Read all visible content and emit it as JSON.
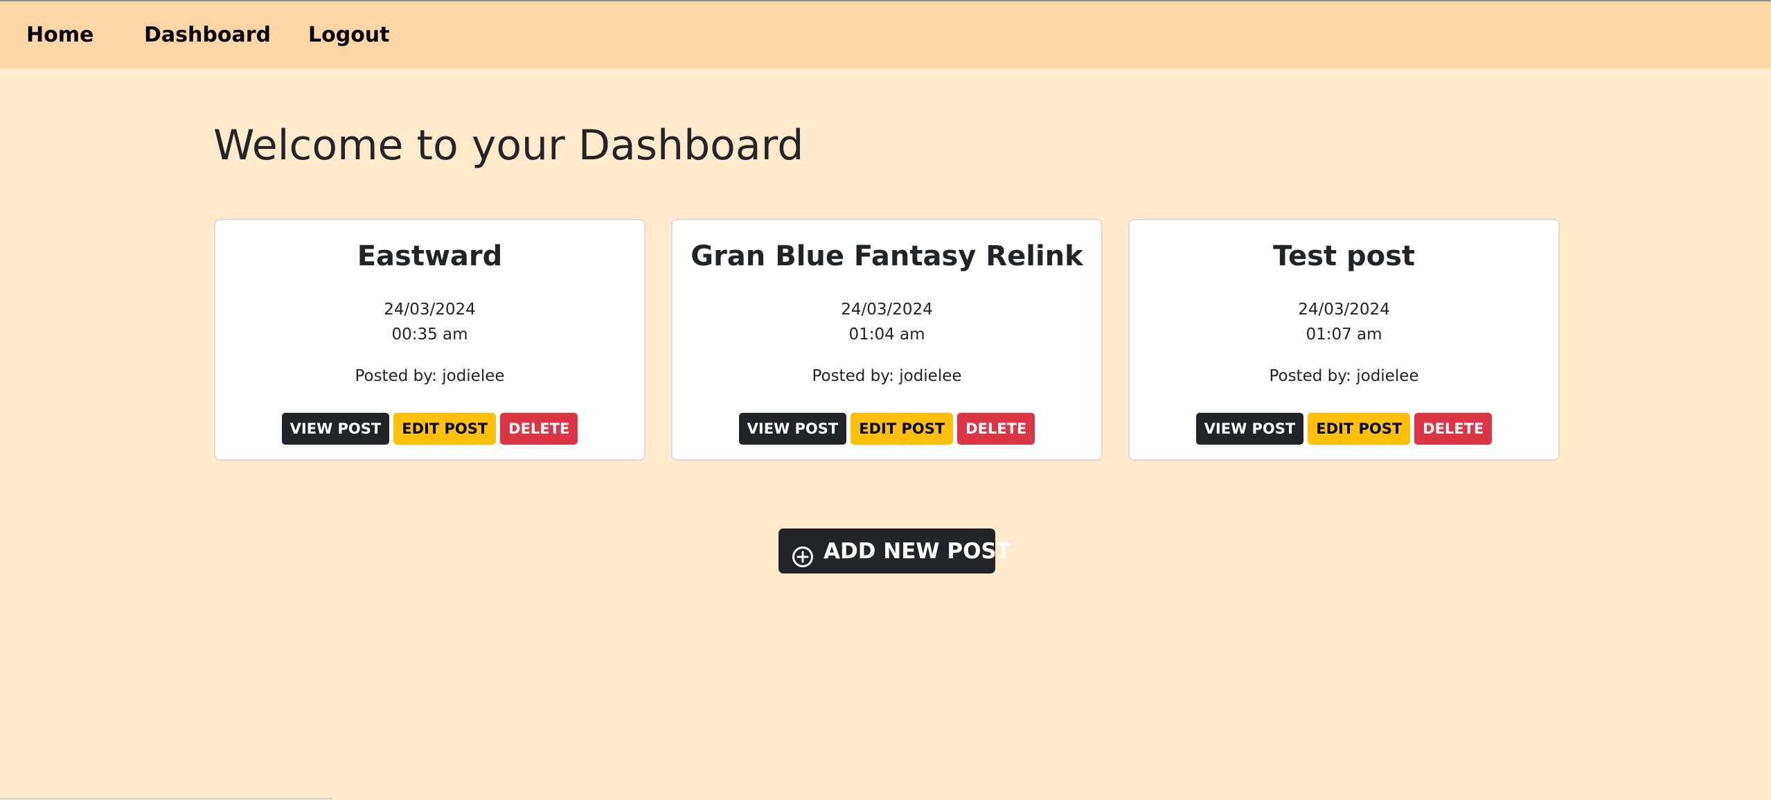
{
  "nav": {
    "home": "Home",
    "dashboard": "Dashboard",
    "logout": "Logout"
  },
  "page": {
    "title": "Welcome to your Dashboard"
  },
  "posts": [
    {
      "title": "Eastward",
      "date": "24/03/2024",
      "time": "00:35 am",
      "author": "Posted by: jodielee",
      "view_label": "VIEW POST",
      "edit_label": "EDIT POST",
      "delete_label": "DELETE"
    },
    {
      "title": "Gran Blue Fantasy Relink",
      "date": "24/03/2024",
      "time": "01:04 am",
      "author": "Posted by: jodielee",
      "view_label": "VIEW POST",
      "edit_label": "EDIT POST",
      "delete_label": "DELETE"
    },
    {
      "title": "Test post",
      "date": "24/03/2024",
      "time": "01:07 am",
      "author": "Posted by: jodielee",
      "view_label": "VIEW POST",
      "edit_label": "EDIT POST",
      "delete_label": "DELETE"
    }
  ],
  "add_post": {
    "label": "ADD NEW POST",
    "icon": "plus-circle-icon"
  },
  "colors": {
    "background": "#ffebcb",
    "navbar": "#ffd6a4",
    "dark": "#212529",
    "warning": "#ffc107",
    "danger": "#dc3545"
  }
}
